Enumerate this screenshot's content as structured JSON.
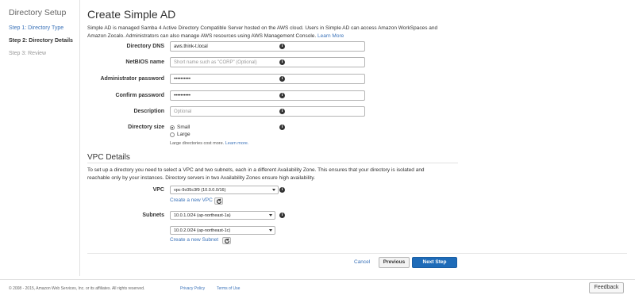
{
  "sidebar": {
    "title": "Directory Setup",
    "steps": [
      {
        "label": "Step 1: Directory Type"
      },
      {
        "label": "Step 2: Directory Details"
      },
      {
        "label": "Step 3: Review"
      }
    ]
  },
  "main": {
    "title": "Create Simple AD",
    "intro_text": "Simple AD is managed Samba 4 Active Directory Compatible Server hosted on the AWS cloud. Users in Simple AD can access Amazon WorkSpaces and Amazon Zocalo. Administrators can also manage AWS resources using AWS Management Console.",
    "intro_link": "Learn More",
    "fields": {
      "directory_dns": {
        "label": "Directory DNS",
        "value": "aws.think-t.local"
      },
      "netbios_name": {
        "label": "NetBIOS name",
        "placeholder": "Short name such as \"CORP\" (Optional)"
      },
      "admin_password": {
        "label": "Administrator password",
        "value": "••••••••••"
      },
      "confirm_password": {
        "label": "Confirm password",
        "value": "••••••••••"
      },
      "description": {
        "label": "Description",
        "placeholder": "Optional"
      },
      "directory_size": {
        "label": "Directory size",
        "options": [
          "Small",
          "Large"
        ],
        "selected": "Small",
        "note": "Large directories cost more.",
        "note_link": "Learn more."
      }
    },
    "vpc": {
      "title": "VPC Details",
      "intro_text": "To set up a directory you need to select a VPC and two subnets, each in a different Availability Zone. This ensures that your directory is isolated and reachable only by your instances. Directory servers in two Availability Zones ensure high availability.",
      "vpc_label": "VPC",
      "vpc_value": "vpc-9c05c3f9 (10.0.0.0/16)",
      "create_vpc_link": "Create a new VPC",
      "subnets_label": "Subnets",
      "subnet1_value": "10.0.1.0/24 (ap-northeast-1a)",
      "subnet2_value": "10.0.2.0/24 (ap-northeast-1c)",
      "create_subnet_link": "Create a new Subnet"
    },
    "actions": {
      "cancel": "Cancel",
      "previous": "Previous",
      "next": "Next Step"
    }
  },
  "footer": {
    "copyright": "© 2008 - 2015, Amazon Web Services, Inc. or its affiliates. All rights reserved.",
    "privacy": "Privacy Policy",
    "terms": "Terms of Use",
    "feedback": "Feedback"
  },
  "colors": {
    "link": "#3b73b9",
    "primary_button": "#1e6bb8"
  }
}
